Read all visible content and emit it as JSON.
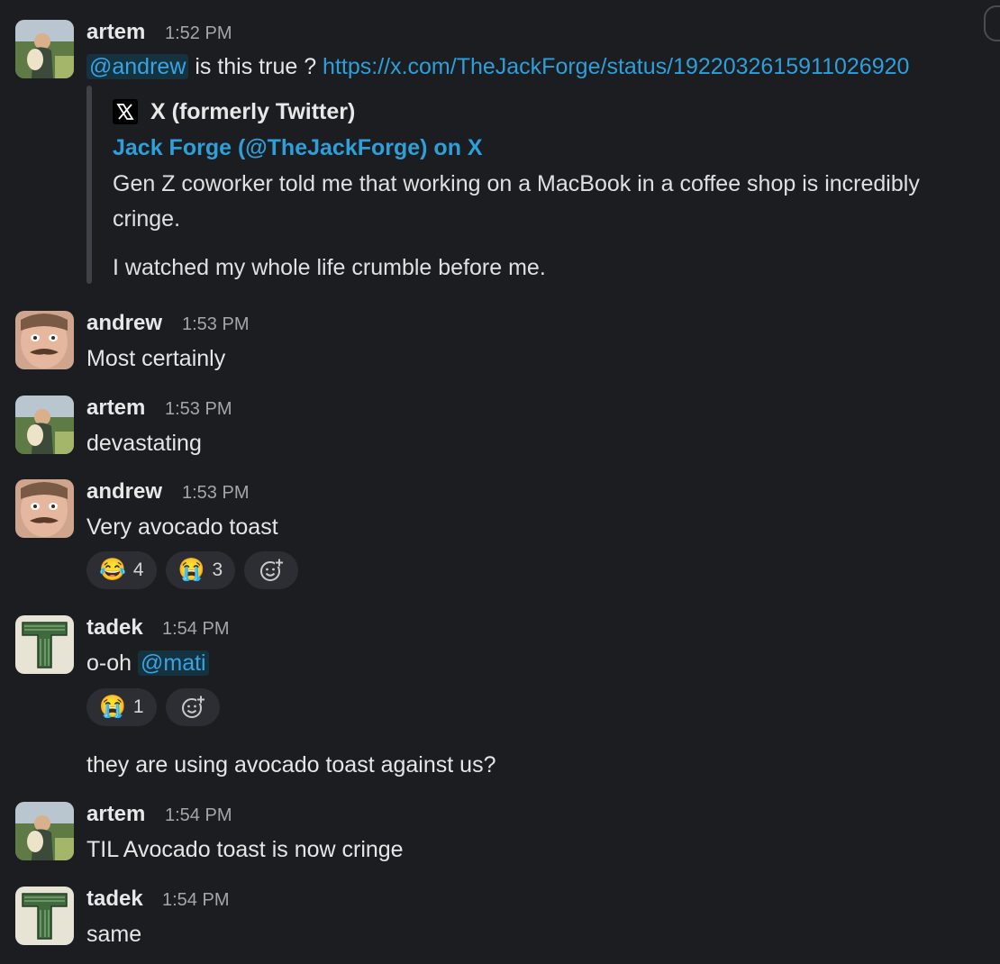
{
  "messages": [
    {
      "author": "artem",
      "time": "1:52 PM",
      "mention": "@andrew",
      "text_after_mention": " is this true ? ",
      "link": "https://x.com/TheJackForge/status/1922032615911026920",
      "unfurl": {
        "site": "X (formerly Twitter)",
        "title": "Jack Forge (@TheJackForge) on X",
        "body_line1": "Gen Z coworker told me that working on a MacBook in a coffee shop is incredibly",
        "body_line2": "cringe.",
        "body_line3": "I watched my whole life crumble before me."
      }
    },
    {
      "author": "andrew",
      "time": "1:53 PM",
      "text": "Most certainly"
    },
    {
      "author": "artem",
      "time": "1:53 PM",
      "text": "devastating"
    },
    {
      "author": "andrew",
      "time": "1:53 PM",
      "text": "Very avocado toast",
      "reactions": [
        {
          "emoji": "😂",
          "count": "4"
        },
        {
          "emoji": "😭",
          "count": "3"
        }
      ]
    },
    {
      "author": "tadek",
      "time": "1:54 PM",
      "text": "o-oh ",
      "mention": "@mati",
      "reactions": [
        {
          "emoji": "😭",
          "count": "1"
        }
      ],
      "followup": "they are using avocado toast against us?"
    },
    {
      "author": "artem",
      "time": "1:54 PM",
      "text": "TIL Avocado toast is now cringe"
    },
    {
      "author": "tadek",
      "time": "1:54 PM",
      "text": "same"
    }
  ],
  "icons": {
    "add_reaction": "add-reaction-icon",
    "x_logo": "x-logo-icon"
  },
  "colors": {
    "background": "#1b1d21",
    "link": "#2e9fd9",
    "mention": "#3aa3e3",
    "reaction_bg": "#2c2e33"
  }
}
